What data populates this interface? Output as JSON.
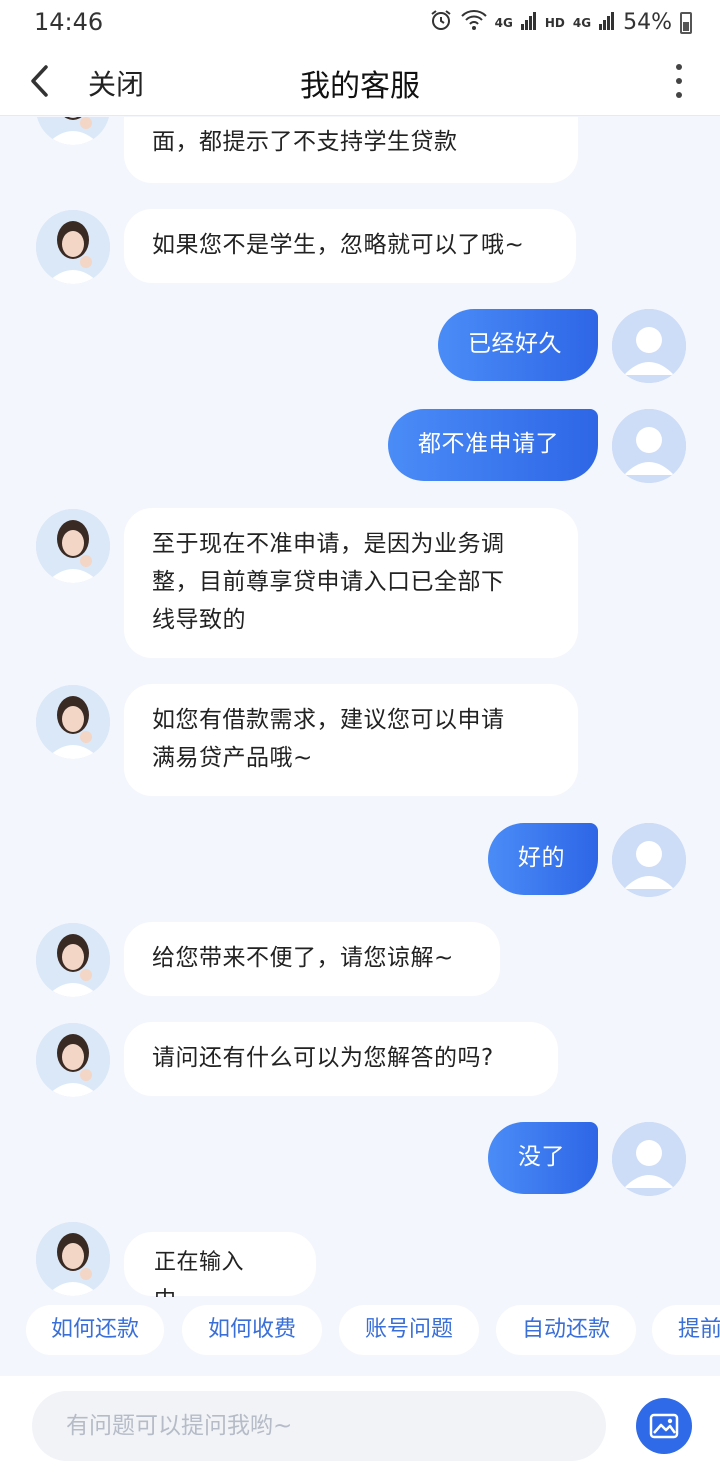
{
  "status_bar": {
    "time": "14:46",
    "network1": "4G",
    "hd": "HD",
    "network2": "4G",
    "battery": "54%"
  },
  "header": {
    "close_label": "关闭",
    "title": "我的客服"
  },
  "messages": [
    {
      "from": "agent",
      "text": "面，都提示了不支持学生贷款"
    },
    {
      "from": "agent",
      "text": "如果您不是学生，忽略就可以了哦~"
    },
    {
      "from": "user",
      "text": "已经好久"
    },
    {
      "from": "user",
      "text": "都不准申请了"
    },
    {
      "from": "agent",
      "lines": [
        "至于现在不准申请，是因为业务调",
        "整，目前尊享贷申请入口已全部下",
        "线导致的"
      ]
    },
    {
      "from": "agent",
      "lines": [
        "如您有借款需求，建议您可以申请",
        "满易贷产品哦~"
      ]
    },
    {
      "from": "user",
      "text": "好的"
    },
    {
      "from": "agent",
      "text": "给您带来不便了，请您谅解~"
    },
    {
      "from": "agent",
      "text": "请问还有什么可以为您解答的吗?"
    },
    {
      "from": "user",
      "text": "没了"
    },
    {
      "from": "agent",
      "text": "正在输入中..."
    }
  ],
  "quick_replies": [
    "如何还款",
    "如何收费",
    "账号问题",
    "自动还款",
    "提前"
  ],
  "input": {
    "placeholder": "有问题可以提问我哟~",
    "value": ""
  },
  "colors": {
    "accent": "#2f6ae8",
    "user_bubble_start": "#4a8cf7",
    "user_bubble_end": "#2e66e6",
    "background": "#f3f6fc"
  },
  "icons": {
    "back": "back-arrow-icon",
    "more": "more-vertical-icon",
    "image": "image-icon",
    "alarm": "alarm-icon",
    "wifi": "wifi-icon"
  }
}
